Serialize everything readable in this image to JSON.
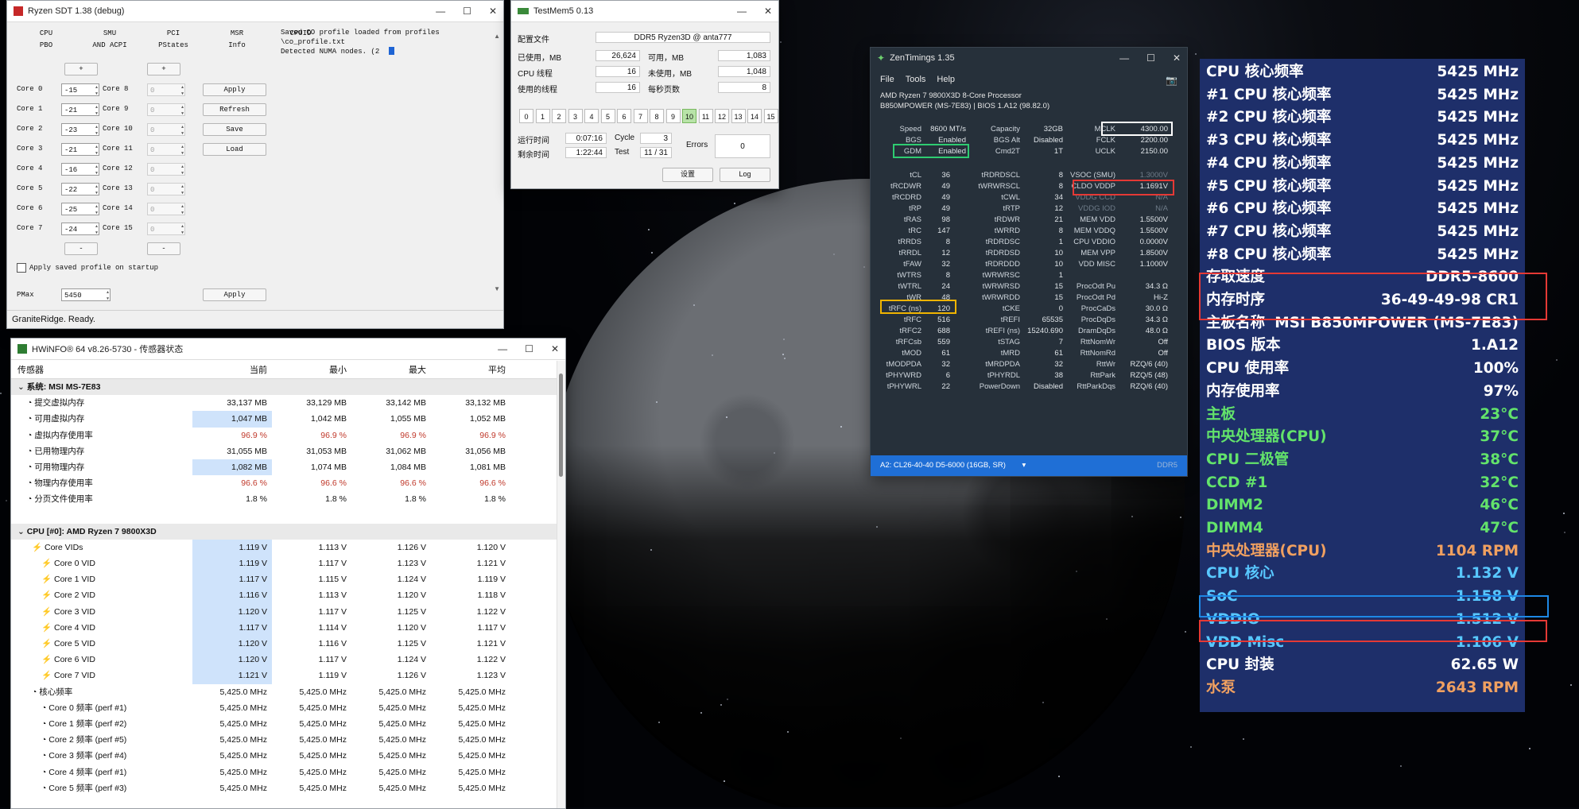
{
  "sdt": {
    "title": "Ryzen SDT 1.38 (debug)",
    "tabs_top": [
      "CPU",
      "SMU",
      "PCI",
      "MSR",
      "CPUID"
    ],
    "tabs_bottom": [
      "PBO",
      "AND ACPI",
      "PStates",
      "Info"
    ],
    "plus": "+",
    "minus": "-",
    "cores_left": [
      {
        "label": "Core 0",
        "value": "-15"
      },
      {
        "label": "Core 1",
        "value": "-21"
      },
      {
        "label": "Core 2",
        "value": "-23"
      },
      {
        "label": "Core 3",
        "value": "-21"
      },
      {
        "label": "Core 4",
        "value": "-16"
      },
      {
        "label": "Core 5",
        "value": "-22"
      },
      {
        "label": "Core 6",
        "value": "-25"
      },
      {
        "label": "Core 7",
        "value": "-24"
      }
    ],
    "cores_right": [
      {
        "label": "Core 8",
        "value": "0"
      },
      {
        "label": "Core 9",
        "value": "0"
      },
      {
        "label": "Core 10",
        "value": "0"
      },
      {
        "label": "Core 11",
        "value": "0"
      },
      {
        "label": "Core 12",
        "value": "0"
      },
      {
        "label": "Core 13",
        "value": "0"
      },
      {
        "label": "Core 14",
        "value": "0"
      },
      {
        "label": "Core 15",
        "value": "0"
      }
    ],
    "buttons": [
      "Apply",
      "Refresh",
      "Save",
      "Load"
    ],
    "apply_saved": "Apply saved profile on startup",
    "pmax_label": "PMax",
    "pmax_value": "5450",
    "pmax_apply": "Apply",
    "log": [
      "Saved CO profile loaded from profiles",
      "\\co_profile.txt",
      "Detected NUMA nodes. (2"
    ],
    "status": "GraniteRidge. Ready."
  },
  "tm5": {
    "title": "TestMem5  0.13",
    "config_label": "配置文件",
    "config_value": "DDR5 Ryzen3D @ anta777",
    "used_label": "已使用，MB",
    "used_value": "26,624",
    "avail_label": "可用，MB",
    "avail_value": "1,083",
    "threads_label": "CPU 线程",
    "threads_value": "16",
    "unused_label": "未使用，MB",
    "unused_value": "1,048",
    "usedthreads_label": "使用的线程",
    "usedthreads_value": "16",
    "pages_label": "每秒页数",
    "pages_value": "8",
    "tests": [
      "0",
      "1",
      "2",
      "3",
      "4",
      "5",
      "6",
      "7",
      "8",
      "9",
      "10",
      "11",
      "12",
      "13",
      "14",
      "15"
    ],
    "active_test": "10",
    "runtime_label": "运行时间",
    "runtime_value": "0:07:16",
    "cycle_label": "Cycle",
    "cycle_value": "3",
    "remain_label": "剩余时间",
    "remain_value": "1:22:44",
    "test_label": "Test",
    "test_value": "11 / 31",
    "errors_label": "Errors",
    "errors_value": "0",
    "settings_btn": "设置",
    "log_btn": "Log"
  },
  "zt": {
    "title": "ZenTimings 1.35",
    "menu": [
      "File",
      "Tools",
      "Help"
    ],
    "cpu_line1": "AMD Ryzen 7 9800X3D 8-Core Processor",
    "cpu_line2": "B850MPOWER (MS-7E83) | BIOS 1.A12 (98.82.0)",
    "top": [
      {
        "l": "Speed",
        "v": "8600 MT/s",
        "l2": "Capacity",
        "v2": "32GB",
        "l3": "MCLK",
        "v3": "4300.00"
      },
      {
        "l": "BGS",
        "v": "Enabled",
        "l2": "BGS Alt",
        "v2": "Disabled",
        "l3": "FCLK",
        "v3": "2200.00"
      },
      {
        "l": "GDM",
        "v": "Enabled",
        "l2": "Cmd2T",
        "v2": "1T",
        "l3": "UCLK",
        "v3": "2150.00"
      }
    ],
    "rows": [
      {
        "a": "tCL",
        "av": "36",
        "b": "tRDRDSCL",
        "bv": "8",
        "c": "VSOC (SMU)",
        "cv": "1.3000V"
      },
      {
        "a": "tRCDWR",
        "av": "49",
        "b": "tWRWRSCL",
        "bv": "8",
        "c": "CLDO VDDP",
        "cv": "1.1691V"
      },
      {
        "a": "tRCDRD",
        "av": "49",
        "b": "tCWL",
        "bv": "34",
        "c": "VDDG CCD",
        "cv": "N/A"
      },
      {
        "a": "tRP",
        "av": "49",
        "b": "tRTP",
        "bv": "12",
        "c": "VDDG IOD",
        "cv": "N/A"
      },
      {
        "a": "tRAS",
        "av": "98",
        "b": "tRDWR",
        "bv": "21",
        "c": "MEM VDD",
        "cv": "1.5500V"
      },
      {
        "a": "tRC",
        "av": "147",
        "b": "tWRRD",
        "bv": "8",
        "c": "MEM VDDQ",
        "cv": "1.5500V"
      },
      {
        "a": "tRRDS",
        "av": "8",
        "b": "tRDRDSC",
        "bv": "1",
        "c": "CPU VDDIO",
        "cv": "0.0000V"
      },
      {
        "a": "tRRDL",
        "av": "12",
        "b": "tRDRDSD",
        "bv": "10",
        "c": "MEM VPP",
        "cv": "1.8500V"
      },
      {
        "a": "tFAW",
        "av": "32",
        "b": "tRDRDDD",
        "bv": "10",
        "c": "VDD MISC",
        "cv": "1.1000V"
      },
      {
        "a": "tWTRS",
        "av": "8",
        "b": "tWRWRSC",
        "bv": "1",
        "c": "",
        "cv": ""
      },
      {
        "a": "tWTRL",
        "av": "24",
        "b": "tWRWRSD",
        "bv": "15",
        "c": "ProcOdt Pu",
        "cv": "34.3 Ω"
      },
      {
        "a": "tWR",
        "av": "48",
        "b": "tWRWRDD",
        "bv": "15",
        "c": "ProcOdt Pd",
        "cv": "Hi-Z"
      },
      {
        "a": "tRFC (ns)",
        "av": "120",
        "b": "tCKE",
        "bv": "0",
        "c": "ProcCaDs",
        "cv": "30.0 Ω"
      },
      {
        "a": "tRFC",
        "av": "516",
        "b": "tREFI",
        "bv": "65535",
        "c": "ProcDqDs",
        "cv": "34.3 Ω"
      },
      {
        "a": "tRFC2",
        "av": "688",
        "b": "tREFI (ns)",
        "bv": "15240.690",
        "c": "DramDqDs",
        "cv": "48.0 Ω"
      },
      {
        "a": "tRFCsb",
        "av": "559",
        "b": "tSTAG",
        "bv": "7",
        "c": "RttNomWr",
        "cv": "Off"
      },
      {
        "a": "tMOD",
        "av": "61",
        "b": "tMRD",
        "bv": "61",
        "c": "RttNomRd",
        "cv": "Off"
      },
      {
        "a": "tMODPDA",
        "av": "32",
        "b": "tMRDPDA",
        "bv": "32",
        "c": "RttWr",
        "cv": "RZQ/6 (40)"
      },
      {
        "a": "tPHYWRD",
        "av": "6",
        "b": "tPHYRDL",
        "bv": "38",
        "c": "RttPark",
        "cv": "RZQ/5 (48)"
      },
      {
        "a": "tPHYWRL",
        "av": "22",
        "b": "PowerDown",
        "bv": "Disabled",
        "c": "RttParkDqs",
        "cv": "RZQ/6 (40)"
      }
    ],
    "footer": "A2: CL26-40-40 D5-6000 (16GB, SR)",
    "footer_right": "DDR5"
  },
  "hw": {
    "title": "HWiNFO® 64 v8.26-5730 - 传感器状态",
    "headers": [
      "传感器",
      "当前",
      "最小",
      "最大",
      "平均"
    ],
    "group1": "系统: MSI MS-7E83",
    "mem_rows": [
      {
        "n": "提交虚拟内存",
        "c": "33,137 MB",
        "mi": "33,129 MB",
        "ma": "33,142 MB",
        "av": "33,132 MB"
      },
      {
        "n": "可用虚拟内存",
        "c": "1,047 MB",
        "mi": "1,042 MB",
        "ma": "1,055 MB",
        "av": "1,052 MB"
      },
      {
        "n": "虚拟内存使用率",
        "c": "96.9 %",
        "mi": "96.9 %",
        "ma": "96.9 %",
        "av": "96.9 %"
      },
      {
        "n": "已用物理内存",
        "c": "31,055 MB",
        "mi": "31,053 MB",
        "ma": "31,062 MB",
        "av": "31,056 MB"
      },
      {
        "n": "可用物理内存",
        "c": "1,082 MB",
        "mi": "1,074 MB",
        "ma": "1,084 MB",
        "av": "1,081 MB"
      },
      {
        "n": "物理内存使用率",
        "c": "96.6 %",
        "mi": "96.6 %",
        "ma": "96.6 %",
        "av": "96.6 %"
      },
      {
        "n": "分页文件使用率",
        "c": "1.8 %",
        "mi": "1.8 %",
        "ma": "1.8 %",
        "av": "1.8 %"
      }
    ],
    "group2": "CPU [#0]: AMD Ryzen 7 9800X3D",
    "vid_rows": [
      {
        "n": "Core VIDs",
        "c": "1.119 V",
        "mi": "1.113 V",
        "ma": "1.126 V",
        "av": "1.120 V"
      },
      {
        "n": "Core 0 VID",
        "c": "1.119 V",
        "mi": "1.117 V",
        "ma": "1.123 V",
        "av": "1.121 V"
      },
      {
        "n": "Core 1 VID",
        "c": "1.117 V",
        "mi": "1.115 V",
        "ma": "1.124 V",
        "av": "1.119 V"
      },
      {
        "n": "Core 2 VID",
        "c": "1.116 V",
        "mi": "1.113 V",
        "ma": "1.120 V",
        "av": "1.118 V"
      },
      {
        "n": "Core 3 VID",
        "c": "1.120 V",
        "mi": "1.117 V",
        "ma": "1.125 V",
        "av": "1.122 V"
      },
      {
        "n": "Core 4 VID",
        "c": "1.117 V",
        "mi": "1.114 V",
        "ma": "1.120 V",
        "av": "1.117 V"
      },
      {
        "n": "Core 5 VID",
        "c": "1.120 V",
        "mi": "1.116 V",
        "ma": "1.125 V",
        "av": "1.121 V"
      },
      {
        "n": "Core 6 VID",
        "c": "1.120 V",
        "mi": "1.117 V",
        "ma": "1.124 V",
        "av": "1.122 V"
      },
      {
        "n": "Core 7 VID",
        "c": "1.121 V",
        "mi": "1.119 V",
        "ma": "1.126 V",
        "av": "1.123 V"
      }
    ],
    "freq_group": "核心频率",
    "freq_rows": [
      {
        "n": "核心频率",
        "c": "5,425.0 MHz",
        "mi": "5,425.0 MHz",
        "ma": "5,425.0 MHz",
        "av": "5,425.0 MHz"
      },
      {
        "n": "Core 0 频率 (perf #1)",
        "c": "5,425.0 MHz",
        "mi": "5,425.0 MHz",
        "ma": "5,425.0 MHz",
        "av": "5,425.0 MHz"
      },
      {
        "n": "Core 1 频率 (perf #2)",
        "c": "5,425.0 MHz",
        "mi": "5,425.0 MHz",
        "ma": "5,425.0 MHz",
        "av": "5,425.0 MHz"
      },
      {
        "n": "Core 2 频率 (perf #5)",
        "c": "5,425.0 MHz",
        "mi": "5,425.0 MHz",
        "ma": "5,425.0 MHz",
        "av": "5,425.0 MHz"
      },
      {
        "n": "Core 3 频率 (perf #4)",
        "c": "5,425.0 MHz",
        "mi": "5,425.0 MHz",
        "ma": "5,425.0 MHz",
        "av": "5,425.0 MHz"
      },
      {
        "n": "Core 4 频率 (perf #1)",
        "c": "5,425.0 MHz",
        "mi": "5,425.0 MHz",
        "ma": "5,425.0 MHz",
        "av": "5,425.0 MHz"
      },
      {
        "n": "Core 5 频率 (perf #3)",
        "c": "5,425.0 MHz",
        "mi": "5,425.0 MHz",
        "ma": "5,425.0 MHz",
        "av": "5,425.0 MHz"
      }
    ]
  },
  "osd": [
    {
      "k": "CPU 核心频率",
      "v": "5425 MHz",
      "color": "#ffffff"
    },
    {
      "k": "#1 CPU 核心频率",
      "v": "5425 MHz",
      "color": "#ffffff"
    },
    {
      "k": "#2 CPU 核心频率",
      "v": "5425 MHz",
      "color": "#ffffff"
    },
    {
      "k": "#3 CPU 核心频率",
      "v": "5425 MHz",
      "color": "#ffffff"
    },
    {
      "k": "#4 CPU 核心频率",
      "v": "5425 MHz",
      "color": "#ffffff"
    },
    {
      "k": "#5 CPU 核心频率",
      "v": "5425 MHz",
      "color": "#ffffff"
    },
    {
      "k": "#6 CPU 核心频率",
      "v": "5425 MHz",
      "color": "#ffffff"
    },
    {
      "k": "#7 CPU 核心频率",
      "v": "5425 MHz",
      "color": "#ffffff"
    },
    {
      "k": "#8 CPU 核心频率",
      "v": "5425 MHz",
      "color": "#ffffff"
    },
    {
      "k": "存取速度",
      "v": "DDR5-8600",
      "color": "#ffffff"
    },
    {
      "k": "内存时序",
      "v": "36-49-49-98 CR1",
      "color": "#ffffff"
    },
    {
      "k": "主板名称",
      "v": "MSI B850MPOWER (MS-7E83)",
      "color": "#ffffff"
    },
    {
      "k": "BIOS 版本",
      "v": "1.A12",
      "color": "#ffffff"
    },
    {
      "k": "CPU 使用率",
      "v": "100%",
      "color": "#ffffff"
    },
    {
      "k": "内存使用率",
      "v": "97%",
      "color": "#ffffff"
    },
    {
      "k": "主板",
      "v": "23°C",
      "color": "#63e36b"
    },
    {
      "k": "中央处理器(CPU)",
      "v": "37°C",
      "color": "#63e36b"
    },
    {
      "k": "CPU 二极管",
      "v": "38°C",
      "color": "#63e36b"
    },
    {
      "k": "CCD #1",
      "v": "32°C",
      "color": "#63e36b"
    },
    {
      "k": "DIMM2",
      "v": "46°C",
      "color": "#63e36b"
    },
    {
      "k": "DIMM4",
      "v": "47°C",
      "color": "#63e36b"
    },
    {
      "k": "中央处理器(CPU)",
      "v": "1104 RPM",
      "color": "#f0a060"
    },
    {
      "k": "CPU 核心",
      "v": "1.132 V",
      "color": "#58c7ff"
    },
    {
      "k": "SoC",
      "v": "1.158 V",
      "color": "#58c7ff"
    },
    {
      "k": "VDDIO",
      "v": "1.512 V",
      "color": "#58c7ff"
    },
    {
      "k": "VDD Misc",
      "v": "1.106 V",
      "color": "#58c7ff"
    },
    {
      "k": "CPU 封装",
      "v": "62.65 W",
      "color": "#ffffff"
    },
    {
      "k": "水泵",
      "v": "2643 RPM",
      "color": "#f0a060"
    }
  ]
}
